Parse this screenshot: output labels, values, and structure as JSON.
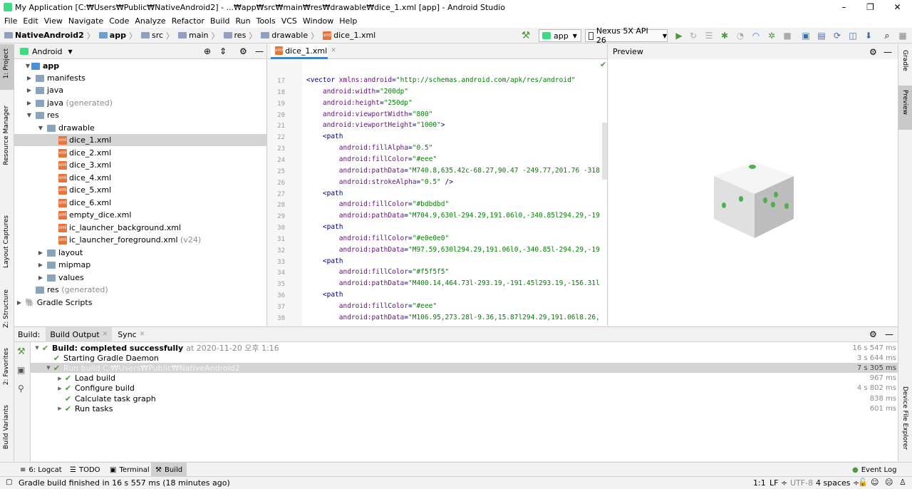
{
  "window": {
    "title": "My Application [C:₩Users₩Public₩NativeAndroid2] - ...₩app₩src₩main₩res₩drawable₩dice_1.xml [app] - Android Studio",
    "minimize": "–",
    "maximize": "❐",
    "close": "✕"
  },
  "menu": [
    "File",
    "Edit",
    "View",
    "Navigate",
    "Code",
    "Analyze",
    "Refactor",
    "Build",
    "Run",
    "Tools",
    "VCS",
    "Window",
    "Help"
  ],
  "breadcrumbs": [
    "NativeAndroid2",
    "app",
    "src",
    "main",
    "res",
    "drawable",
    "dice_1.xml"
  ],
  "toolbar": {
    "run_config": "app",
    "device": "Nexus 5X API 26"
  },
  "left_strip": {
    "project": "1: Project",
    "resource_manager": "Resource Manager",
    "layout_captures": "Layout Captures",
    "structure": "Z: Structure",
    "favorites": "2: Favorites",
    "build_variants": "Build Variants"
  },
  "right_strip": {
    "gradle": "Gradle",
    "preview": "Preview",
    "device_file_explorer": "Device File Explorer"
  },
  "project_panel": {
    "view_mode": "Android",
    "tree": [
      {
        "label": "app",
        "bold": true
      },
      {
        "label": "manifests"
      },
      {
        "label": "java"
      },
      {
        "label": "java",
        "suffix": "(generated)"
      },
      {
        "label": "res"
      },
      {
        "label": "drawable"
      },
      {
        "label": "dice_1.xml"
      },
      {
        "label": "dice_2.xml"
      },
      {
        "label": "dice_3.xml"
      },
      {
        "label": "dice_4.xml"
      },
      {
        "label": "dice_5.xml"
      },
      {
        "label": "dice_6.xml"
      },
      {
        "label": "empty_dice.xml"
      },
      {
        "label": "ic_launcher_background.xml"
      },
      {
        "label": "ic_launcher_foreground.xml",
        "suffix": "(v24)"
      },
      {
        "label": "layout"
      },
      {
        "label": "mipmap"
      },
      {
        "label": "values"
      },
      {
        "label": "res",
        "suffix": "(generated)"
      },
      {
        "label": "Gradle Scripts"
      }
    ]
  },
  "editor": {
    "tab": "dice_1.xml",
    "lines": [
      {
        "n": "17",
        "parts": [
          [
            "t",
            "<vector "
          ],
          [
            "a",
            "xmlns:android"
          ],
          [
            "t",
            "="
          ],
          [
            "v",
            "\"http://schemas.android.com/apk/res/android\""
          ]
        ]
      },
      {
        "n": "18",
        "parts": [
          [
            "t",
            "    "
          ],
          [
            "a",
            "android:width"
          ],
          [
            "t",
            "="
          ],
          [
            "v",
            "\"200dp\""
          ]
        ]
      },
      {
        "n": "19",
        "parts": [
          [
            "t",
            "    "
          ],
          [
            "a",
            "android:height"
          ],
          [
            "t",
            "="
          ],
          [
            "v",
            "\"250dp\""
          ]
        ]
      },
      {
        "n": "20",
        "parts": [
          [
            "t",
            "    "
          ],
          [
            "a",
            "android:viewportWidth"
          ],
          [
            "t",
            "="
          ],
          [
            "v",
            "\"800\""
          ]
        ]
      },
      {
        "n": "21",
        "parts": [
          [
            "t",
            "    "
          ],
          [
            "a",
            "android:viewportHeight"
          ],
          [
            "t",
            "="
          ],
          [
            "v",
            "\"1000\""
          ],
          [
            "t",
            ">"
          ]
        ]
      },
      {
        "n": "22",
        "parts": [
          [
            "t",
            "    <path"
          ]
        ]
      },
      {
        "n": "23",
        "parts": [
          [
            "t",
            "        "
          ],
          [
            "a",
            "android:fillAlpha"
          ],
          [
            "t",
            "="
          ],
          [
            "v",
            "\"0.5\""
          ]
        ]
      },
      {
        "n": "24",
        "parts": [
          [
            "t",
            "        "
          ],
          [
            "a",
            "android:fillColor"
          ],
          [
            "t",
            "="
          ],
          [
            "v",
            "\"#eee\""
          ]
        ]
      },
      {
        "n": "25",
        "parts": [
          [
            "t",
            "        "
          ],
          [
            "a",
            "android:pathData"
          ],
          [
            "t",
            "="
          ],
          [
            "v",
            "\"M740.8,635.42c-68.27,90.47 -249.77,201.76 -318"
          ]
        ]
      },
      {
        "n": "26",
        "parts": [
          [
            "t",
            "        "
          ],
          [
            "a",
            "android:strokeAlpha"
          ],
          [
            "t",
            "="
          ],
          [
            "v",
            "\"0.5\""
          ],
          [
            "t",
            " />"
          ]
        ]
      },
      {
        "n": "27",
        "parts": [
          [
            "t",
            "    <path"
          ]
        ]
      },
      {
        "n": "28",
        "parts": [
          [
            "t",
            "        "
          ],
          [
            "a",
            "android:fillColor"
          ],
          [
            "t",
            "="
          ],
          [
            "v",
            "\"#bdbdbd\""
          ]
        ]
      },
      {
        "n": "29",
        "parts": [
          [
            "t",
            "        "
          ],
          [
            "a",
            "android:pathData"
          ],
          [
            "t",
            "="
          ],
          [
            "v",
            "\"M704.9,630l-294.29,191.06l0,-340.85l294.29,-19"
          ]
        ]
      },
      {
        "n": "30",
        "parts": [
          [
            "t",
            "    <path"
          ]
        ]
      },
      {
        "n": "31",
        "parts": [
          [
            "t",
            "        "
          ],
          [
            "a",
            "android:fillColor"
          ],
          [
            "t",
            "="
          ],
          [
            "v",
            "\"#e0e0e0\""
          ]
        ]
      },
      {
        "n": "32",
        "parts": [
          [
            "t",
            "        "
          ],
          [
            "a",
            "android:pathData"
          ],
          [
            "t",
            "="
          ],
          [
            "v",
            "\"M97.59,630l294.29,191.06l0,-340.85l-294.29,-19"
          ]
        ]
      },
      {
        "n": "33",
        "parts": [
          [
            "t",
            "    <path"
          ]
        ]
      },
      {
        "n": "34",
        "parts": [
          [
            "t",
            "        "
          ],
          [
            "a",
            "android:fillColor"
          ],
          [
            "t",
            "="
          ],
          [
            "v",
            "\"#f5f5f5\""
          ]
        ]
      },
      {
        "n": "35",
        "parts": [
          [
            "t",
            "        "
          ],
          [
            "a",
            "android:pathData"
          ],
          [
            "t",
            "="
          ],
          [
            "v",
            "\"M400.14,464.73l-293.19,-191.45l293.19,-156.31l"
          ]
        ]
      },
      {
        "n": "36",
        "parts": [
          [
            "t",
            "    <path"
          ]
        ]
      },
      {
        "n": "37",
        "parts": [
          [
            "t",
            "        "
          ],
          [
            "a",
            "android:fillColor"
          ],
          [
            "t",
            "="
          ],
          [
            "v",
            "\"#eee\""
          ]
        ]
      },
      {
        "n": "38",
        "parts": [
          [
            "t",
            "        "
          ],
          [
            "a",
            "android:pathData"
          ],
          [
            "t",
            "="
          ],
          [
            "v",
            "\"M106.95,273.28l-9.36,15.87l294.29,191.06l8.26,"
          ]
        ]
      }
    ]
  },
  "preview": {
    "title": "Preview"
  },
  "build": {
    "label": "Build:",
    "tabs": [
      "Build Output",
      "Sync"
    ],
    "rows": [
      {
        "text": "Build: completed successfully",
        "extra": "at 2020-11-20 오후 1:16",
        "time": "16 s 547 ms",
        "indent": 0,
        "arrow": "▼"
      },
      {
        "text": "Starting Gradle Daemon",
        "extra": "",
        "time": "3 s 644 ms",
        "indent": 1,
        "arrow": ""
      },
      {
        "text": "Run build C:₩Users₩Public₩NativeAndroid2",
        "extra": "",
        "time": "7 s 305 ms",
        "indent": 1,
        "arrow": "▼"
      },
      {
        "text": "Load build",
        "extra": "",
        "time": "967 ms",
        "indent": 2,
        "arrow": "▶"
      },
      {
        "text": "Configure build",
        "extra": "",
        "time": "4 s 802 ms",
        "indent": 2,
        "arrow": "▶"
      },
      {
        "text": "Calculate task graph",
        "extra": "",
        "time": "838 ms",
        "indent": 2,
        "arrow": ""
      },
      {
        "text": "Run tasks",
        "extra": "",
        "time": "601 ms",
        "indent": 2,
        "arrow": "▶"
      }
    ]
  },
  "bottom_tabs": [
    "6: Logcat",
    "TODO",
    "Terminal",
    "Build"
  ],
  "event_log": "Event Log",
  "status": {
    "message": "Gradle build finished in 16 s 557 ms (18 minutes ago)",
    "position": "1:1",
    "line_sep": "LF ÷",
    "encoding": "UTF-8",
    "indent": "4 spaces ÷"
  }
}
